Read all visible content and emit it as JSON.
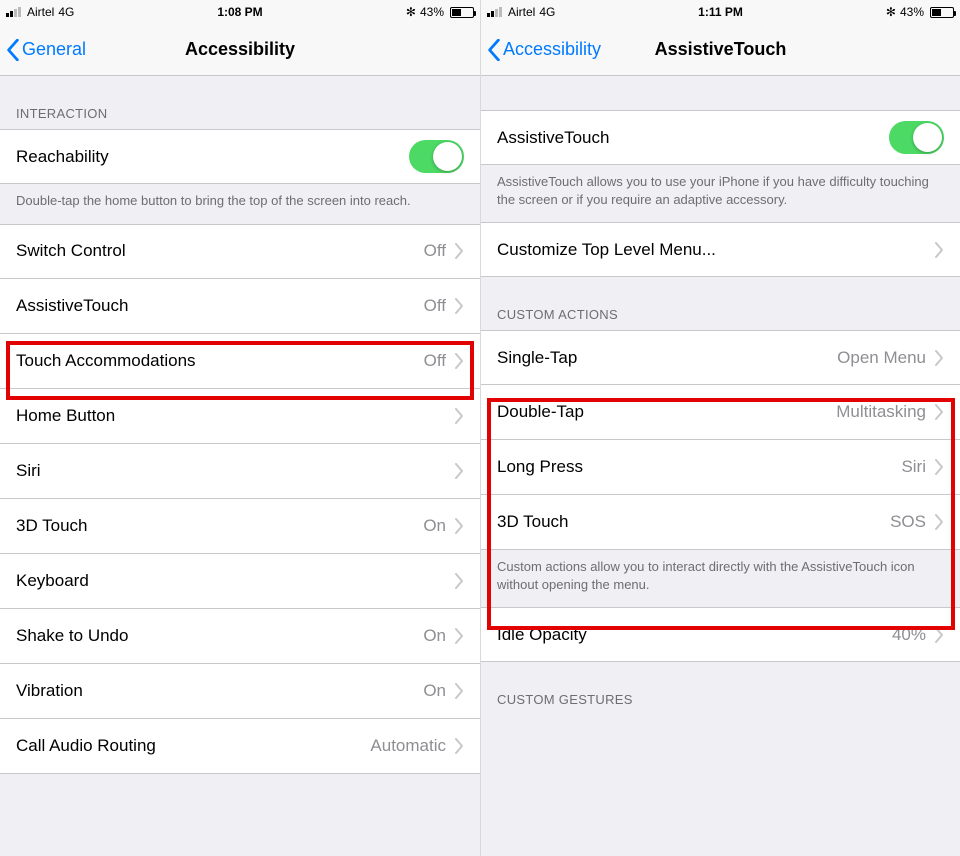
{
  "left": {
    "status": {
      "carrier": "Airtel",
      "net": "4G",
      "time": "1:08 PM",
      "battery": "43%"
    },
    "nav": {
      "back": "General",
      "title": "Accessibility"
    },
    "sections": {
      "interaction_header": "INTERACTION",
      "reachability": "Reachability",
      "reach_footer": "Double-tap the home button to bring the top of the screen into reach."
    },
    "rows": {
      "switch_control": {
        "label": "Switch Control",
        "value": "Off"
      },
      "assistive_touch": {
        "label": "AssistiveTouch",
        "value": "Off"
      },
      "touch_accom": {
        "label": "Touch Accommodations",
        "value": "Off"
      },
      "home_button": {
        "label": "Home Button",
        "value": ""
      },
      "siri": {
        "label": "Siri",
        "value": ""
      },
      "threeD_touch": {
        "label": "3D Touch",
        "value": "On"
      },
      "keyboard": {
        "label": "Keyboard",
        "value": ""
      },
      "shake_undo": {
        "label": "Shake to Undo",
        "value": "On"
      },
      "vibration": {
        "label": "Vibration",
        "value": "On"
      },
      "call_audio": {
        "label": "Call Audio Routing",
        "value": "Automatic"
      }
    }
  },
  "right": {
    "status": {
      "carrier": "Airtel",
      "net": "4G",
      "time": "1:11 PM",
      "battery": "43%"
    },
    "nav": {
      "back": "Accessibility",
      "title": "AssistiveTouch"
    },
    "rows": {
      "at_toggle": {
        "label": "AssistiveTouch"
      },
      "at_footer": "AssistiveTouch allows you to use your iPhone if you have difficulty touching the screen or if you require an adaptive accessory.",
      "customize": {
        "label": "Customize Top Level Menu..."
      },
      "ca_header": "CUSTOM ACTIONS",
      "single_tap": {
        "label": "Single-Tap",
        "value": "Open Menu"
      },
      "double_tap": {
        "label": "Double-Tap",
        "value": "Multitasking"
      },
      "long_press": {
        "label": "Long Press",
        "value": "Siri"
      },
      "threeD": {
        "label": "3D Touch",
        "value": "SOS"
      },
      "ca_footer": "Custom actions allow you to interact directly with the AssistiveTouch icon without opening the menu.",
      "idle": {
        "label": "Idle Opacity",
        "value": "40%"
      },
      "cg_header": "CUSTOM GESTURES"
    }
  }
}
